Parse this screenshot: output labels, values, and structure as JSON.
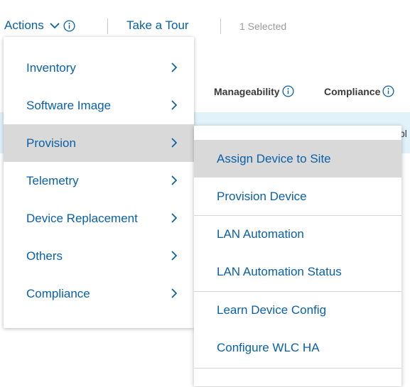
{
  "toolbar": {
    "actions_label": "Actions",
    "tour_label": "Take a Tour",
    "selected_text": "1 Selected"
  },
  "table": {
    "columns": [
      {
        "label": "Manageability"
      },
      {
        "label": "Compliance"
      }
    ],
    "row_fragment": "pl"
  },
  "menu": {
    "items": [
      {
        "label": "Inventory"
      },
      {
        "label": "Software Image"
      },
      {
        "label": "Provision"
      },
      {
        "label": "Telemetry"
      },
      {
        "label": "Device Replacement"
      },
      {
        "label": "Others"
      },
      {
        "label": "Compliance"
      }
    ],
    "active_item": "Provision"
  },
  "submenu": {
    "items": [
      {
        "label": "Assign Device to Site"
      },
      {
        "label": "Provision Device"
      },
      {
        "label": "LAN Automation"
      },
      {
        "label": "LAN Automation Status"
      },
      {
        "label": "Learn Device Config"
      },
      {
        "label": "Configure WLC HA"
      }
    ],
    "active_item": "Assign Device to Site"
  },
  "colors": {
    "link_blue": "#0a60a8",
    "active_bg": "#d9d9d9",
    "selected_row_bg": "#e2f2fb"
  },
  "icons": {
    "actions_chevron": "chevron-down-icon",
    "info": "info-icon",
    "menu_arrow": "chevron-right-icon"
  }
}
